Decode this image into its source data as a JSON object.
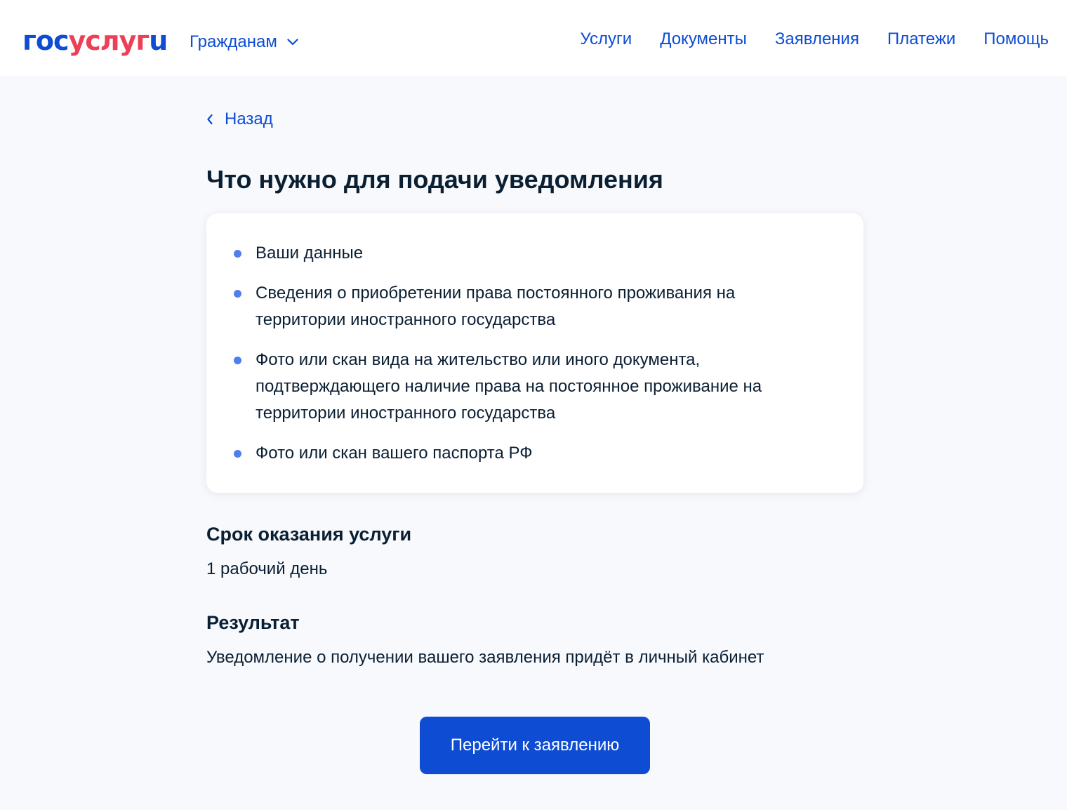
{
  "header": {
    "logo": {
      "part1": "гос",
      "part2": "услуг",
      "part3": "u"
    },
    "audience_label": "Гражданам",
    "nav": [
      "Услуги",
      "Документы",
      "Заявления",
      "Платежи",
      "Помощь"
    ]
  },
  "back_label": "Назад",
  "page_title": "Что нужно для подачи уведомления",
  "requirements": [
    "Ваши данные",
    "Сведения о приобретении права постоянного проживания на территории иностранного государства",
    "Фото или скан вида на жительство или иного документа, подтверждающего наличие права на постоянное проживание на территории иностранного государства",
    "Фото или скан вашего паспорта РФ"
  ],
  "duration": {
    "title": "Срок оказания услуги",
    "text": "1 рабочий день"
  },
  "result": {
    "title": "Результат",
    "text": "Уведомление о получении вашего заявления придёт в личный кабинет"
  },
  "cta_label": "Перейти к заявлению",
  "colors": {
    "primary": "#0d4cd3",
    "logo_red": "#ee3f58",
    "bullet": "#4e7ef0",
    "page_bg": "#f7f9fc",
    "text": "#0b1f33"
  }
}
